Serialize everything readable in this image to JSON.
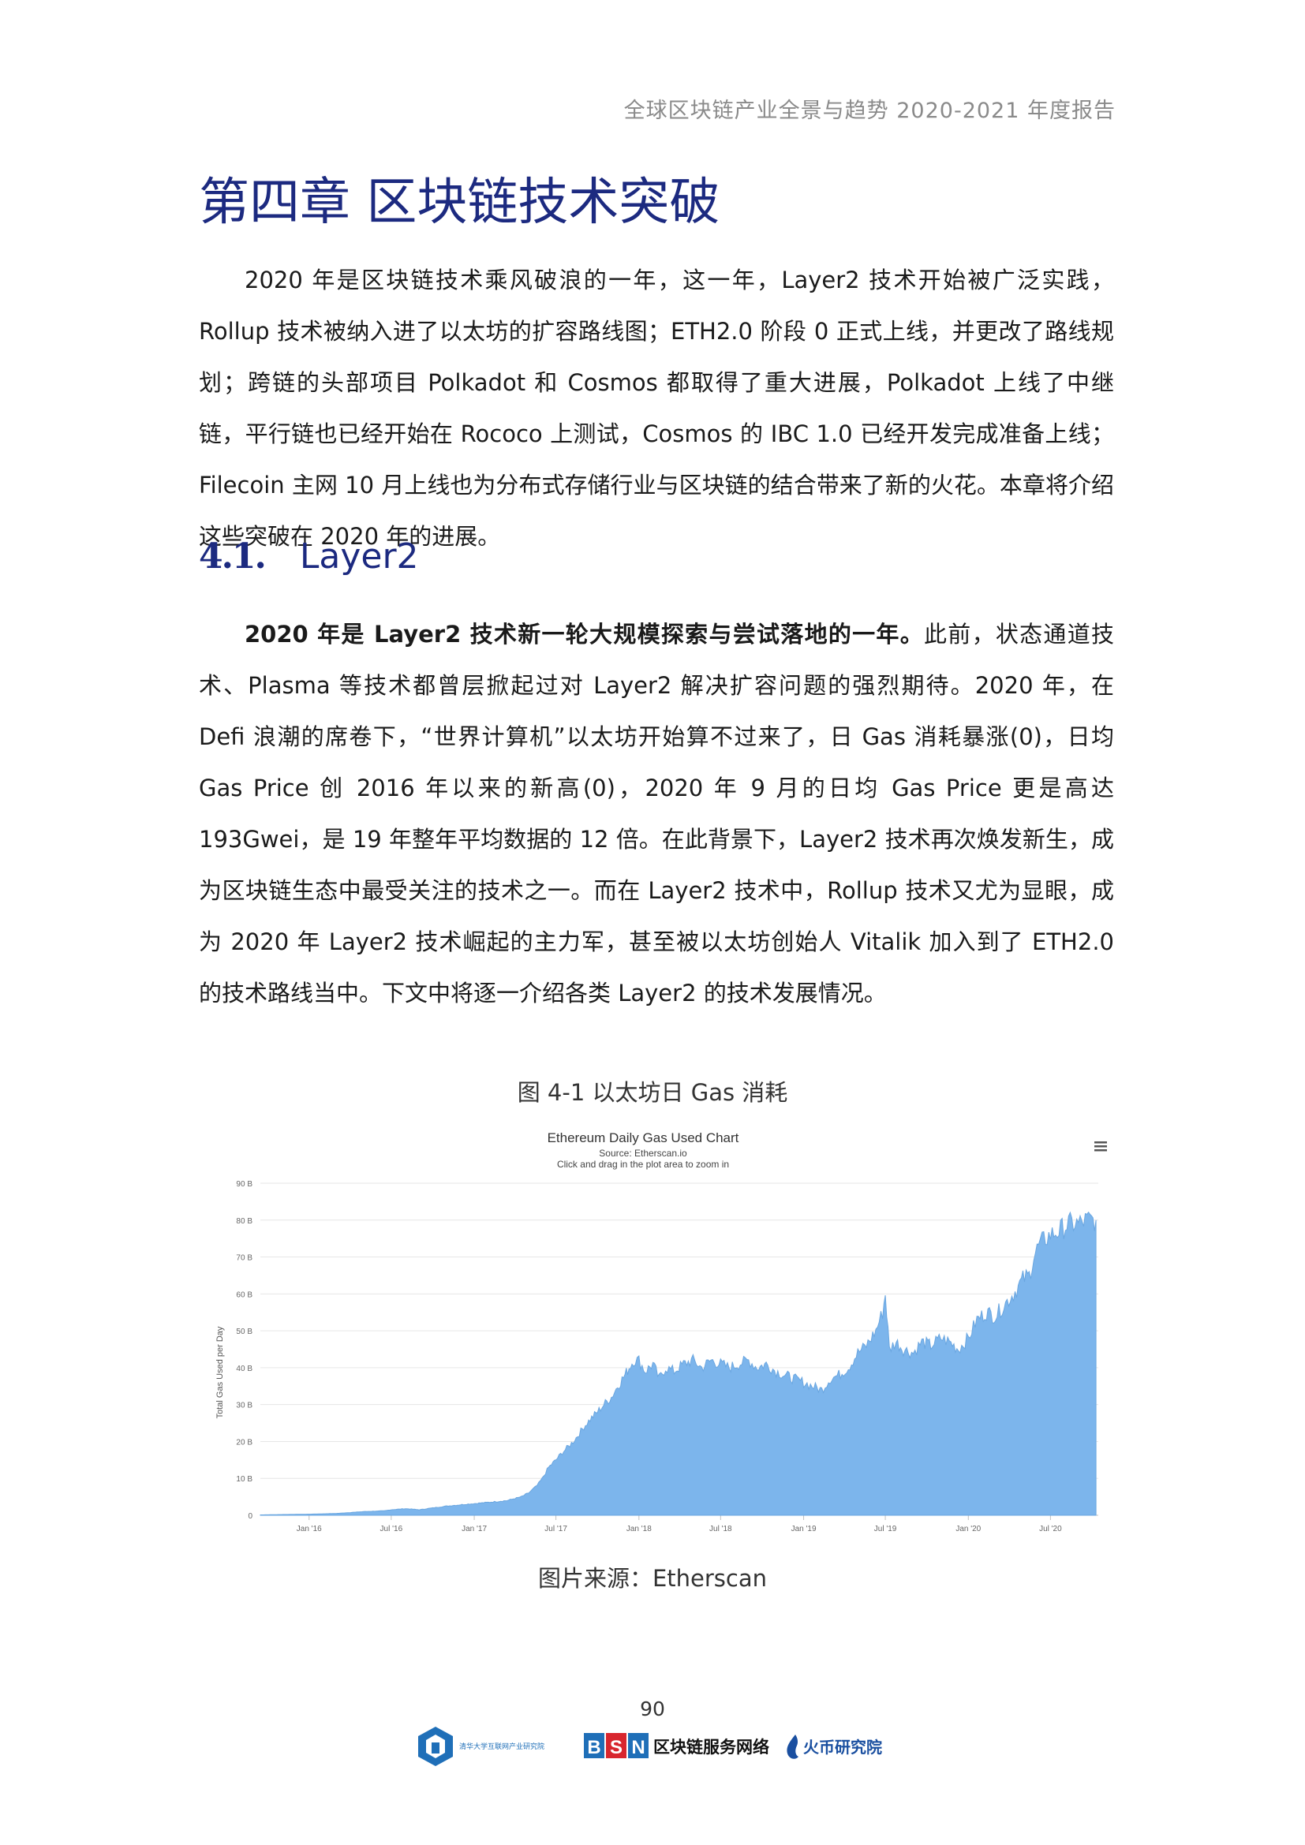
{
  "header": {
    "running_title": "全球区块链产业全景与趋势 2020-2021 年度报告"
  },
  "chapter": {
    "title": "第四章  区块链技术突破"
  },
  "intro_paragraph": "2020 年是区块链技术乘风破浪的一年，这一年，Layer2 技术开始被广泛实践，Rollup 技术被纳入进了以太坊的扩容路线图；ETH2.0 阶段 0 正式上线，并更改了路线规划；跨链的头部项目 Polkadot 和 Cosmos 都取得了重大进展，Polkadot 上线了中继链，平行链也已经开始在 Rococo 上测试，Cosmos 的 IBC 1.0 已经开发完成准备上线；Filecoin 主网 10 月上线也为分布式存储行业与区块链的结合带来了新的火花。本章将介绍这些突破在 2020 年的进展。",
  "section": {
    "number": "4.1.",
    "title": "Layer2",
    "para_bold": "2020 年是 Layer2 技术新一轮大规模探索与尝试落地的一年。",
    "para_rest": "此前，状态通道技术、Plasma 等技术都曾层掀起过对 Layer2 解决扩容问题的强烈期待。2020 年，在 Defi 浪潮的席卷下，“世界计算机”以太坊开始算不过来了，日 Gas 消耗暴涨(0)，日均 Gas Price 创 2016 年以来的新高(0)，2020 年 9 月的日均 Gas Price 更是高达 193Gwei，是 19 年整年平均数据的 12 倍。在此背景下，Layer2 技术再次焕发新生，成为区块链生态中最受关注的技术之一。而在 Layer2 技术中，Rollup 技术又尤为显眼，成为 2020 年 Layer2 技术崛起的主力军，甚至被以太坊创始人 Vitalik 加入到了 ETH2.0 的技术路线当中。下文中将逐一介绍各类 Layer2 的技术发展情况。"
  },
  "figure": {
    "caption": "图 4-1  以太坊日 Gas 消耗",
    "source": "图片来源：Etherscan"
  },
  "chart_data": {
    "type": "area",
    "title": "Ethereum Daily Gas Used Chart",
    "subtitle": "Source: Etherscan.io",
    "note": "Click and drag in the plot area to zoom in",
    "ylabel": "Total Gas Used per Day",
    "ylim": [
      0,
      90
    ],
    "yticks": [
      0,
      10,
      20,
      30,
      40,
      50,
      60,
      70,
      80,
      90
    ],
    "ytick_labels": [
      "0",
      "10 B",
      "20 B",
      "30 B",
      "40 B",
      "50 B",
      "60 B",
      "70 B",
      "80 B",
      "90 B"
    ],
    "xlim": [
      "2015-09-15",
      "2020-10-15"
    ],
    "xtick_dates": [
      "2016-01-01",
      "2016-07-01",
      "2017-01-01",
      "2017-07-01",
      "2018-01-01",
      "2018-07-01",
      "2019-01-01",
      "2019-07-01",
      "2020-01-01",
      "2020-07-01"
    ],
    "xtick_labels": [
      "Jan '16",
      "Jul '16",
      "Jan '17",
      "Jul '17",
      "Jan '18",
      "Jul '18",
      "Jan '19",
      "Jul '19",
      "Jan '20",
      "Jul '20"
    ],
    "grid": true,
    "color": "#7cb5ec",
    "series": [
      {
        "dates": [
          "2015-09-15",
          "2015-11-01",
          "2016-01-01",
          "2016-03-01",
          "2016-05-01",
          "2016-06-15",
          "2016-07-01",
          "2016-08-01",
          "2016-09-01",
          "2016-10-01",
          "2016-11-01",
          "2016-12-15",
          "2017-02-01",
          "2017-03-15",
          "2017-04-15",
          "2017-05-01",
          "2017-05-20",
          "2017-06-01",
          "2017-06-15",
          "2017-07-01",
          "2017-07-15",
          "2017-08-01",
          "2017-08-15",
          "2017-09-01",
          "2017-09-15",
          "2017-10-01",
          "2017-10-15",
          "2017-11-01",
          "2017-11-15",
          "2017-12-01",
          "2017-12-10",
          "2017-12-20",
          "2018-01-01",
          "2018-01-15",
          "2018-02-01",
          "2018-02-15",
          "2018-03-01",
          "2018-03-20",
          "2018-04-10",
          "2018-05-01",
          "2018-05-20",
          "2018-06-10",
          "2018-07-01",
          "2018-07-20",
          "2018-08-10",
          "2018-09-01",
          "2018-09-20",
          "2018-10-10",
          "2018-11-01",
          "2018-11-20",
          "2018-12-10",
          "2019-01-01",
          "2019-01-20",
          "2019-02-10",
          "2019-03-01",
          "2019-03-20",
          "2019-04-10",
          "2019-05-01",
          "2019-05-20",
          "2019-06-10",
          "2019-06-25",
          "2019-07-01",
          "2019-07-10",
          "2019-07-25",
          "2019-08-10",
          "2019-09-01",
          "2019-09-20",
          "2019-10-10",
          "2019-11-01",
          "2019-11-20",
          "2019-12-10",
          "2020-01-01",
          "2020-01-20",
          "2020-02-10",
          "2020-03-01",
          "2020-03-20",
          "2020-04-10",
          "2020-05-01",
          "2020-05-15",
          "2020-05-25",
          "2020-06-05",
          "2020-06-20",
          "2020-07-01",
          "2020-07-20",
          "2020-08-10",
          "2020-09-01",
          "2020-09-20",
          "2020-10-10"
        ],
        "values": [
          0.1,
          0.2,
          0.3,
          0.5,
          1,
          1.2,
          1.5,
          1.8,
          1.5,
          2,
          2.5,
          3,
          3.5,
          4,
          5,
          6,
          8,
          10,
          13,
          15,
          17,
          19,
          21,
          24,
          26,
          28,
          30,
          32,
          35,
          38,
          40,
          42,
          42,
          39,
          41,
          37,
          40,
          39,
          41,
          42,
          40,
          42,
          41,
          40,
          41,
          42,
          40,
          41,
          39,
          38,
          37,
          36,
          35,
          34,
          37,
          38,
          40,
          44,
          46,
          50,
          55,
          60,
          45,
          47,
          45,
          44,
          47,
          46,
          48,
          47,
          45,
          48,
          53,
          55,
          54,
          57,
          60,
          64,
          65,
          70,
          73,
          75,
          76,
          77,
          79,
          79,
          80,
          80
        ]
      }
    ]
  },
  "footer": {
    "page_number": "90",
    "logo_1": "清华大学互联网产业研究院",
    "logo_bsn": [
      "B",
      "S",
      "N"
    ],
    "logo_bsn_text": "区块链服务网络",
    "logo_huobi": "火币研究院",
    "brand_colors": {
      "bsn_blue": "#1f6fb8",
      "bsn_red": "#d8262e",
      "huobi": "#1a4fa0",
      "title_blue": "#1c2a80"
    }
  }
}
